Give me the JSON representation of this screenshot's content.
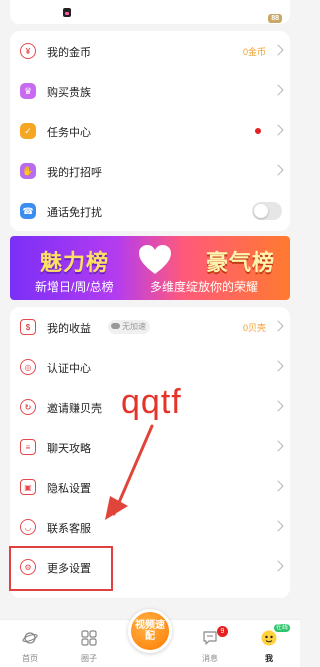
{
  "top": {
    "badge": "88"
  },
  "menu_group_1": [
    {
      "label": "我的金币",
      "value": "0金币",
      "value_color": "#f0a030",
      "icon": "coin-icon",
      "icon_color": "#e5484d"
    },
    {
      "label": "购买贵族",
      "icon": "crown-icon",
      "icon_color": "#c96bf0"
    },
    {
      "label": "任务中心",
      "icon": "task-icon",
      "icon_color": "#f5a623"
    },
    {
      "label": "我的打招呼",
      "icon": "wave-hand-icon",
      "icon_color": "#b86cf0"
    },
    {
      "label": "通话免打扰",
      "icon": "do-not-disturb-icon",
      "icon_color": "#3b8ef0"
    }
  ],
  "banner": {
    "left_title": "魅力榜",
    "right_title": "豪气榜",
    "left_subtitle": "新增日/周/总榜",
    "right_subtitle": "多维度绽放你的荣耀"
  },
  "menu_group_2": [
    {
      "label": "我的收益",
      "tag": "无加速",
      "value": "0贝壳",
      "value_color": "#f0a030",
      "icon": "earnings-icon"
    },
    {
      "label": "认证中心",
      "icon": "verify-icon"
    },
    {
      "label": "邀请赚贝壳",
      "icon": "invite-icon"
    },
    {
      "label": "聊天攻略",
      "icon": "chat-guide-icon"
    },
    {
      "label": "隐私设置",
      "icon": "lock-icon"
    },
    {
      "label": "联系客服",
      "icon": "headset-icon"
    },
    {
      "label": "更多设置",
      "icon": "settings-icon"
    }
  ],
  "annotation": {
    "text": "qqtf"
  },
  "bottom_nav": {
    "home": "首页",
    "circle": "圈子",
    "center": "视频速配",
    "messages": "消息",
    "messages_badge": "9",
    "me": "我",
    "online": "在线"
  }
}
